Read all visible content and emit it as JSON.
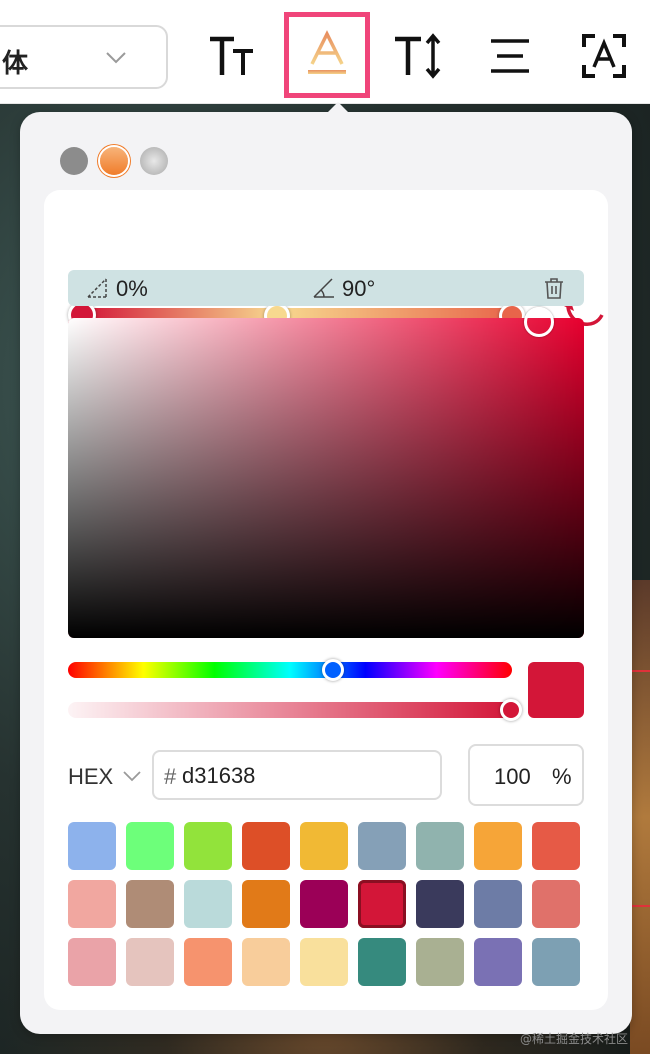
{
  "toolbar": {
    "font_select": {
      "label": "体",
      "icon": "chevron-down-icon"
    },
    "tools": [
      {
        "icon": "text-size-icon"
      },
      {
        "icon": "text-color-gradient-icon",
        "active": true
      },
      {
        "icon": "line-height-icon"
      },
      {
        "icon": "text-align-center-icon"
      },
      {
        "icon": "text-stroke-icon"
      }
    ]
  },
  "color_picker": {
    "modes": [
      {
        "name": "solid",
        "color": "#8c8c8c"
      },
      {
        "name": "linear-gradient",
        "color": "#f07c2a",
        "selected": true
      },
      {
        "name": "radial-gradient",
        "color": "#bdbdbd"
      }
    ],
    "gradient": {
      "stops": [
        {
          "color": "#d31638",
          "position": 0
        },
        {
          "color": "#f7d98f",
          "position": 0.45
        },
        {
          "color": "#e8654a",
          "position": 1
        }
      ],
      "reset_icon": "rotate-ccw-icon"
    },
    "angle_bar": {
      "position_value": "0%",
      "angle_value": "90°",
      "delete_icon": "trash-icon"
    },
    "hue": 0.6,
    "alpha": 1.0,
    "format_label": "HEX",
    "hash": "#",
    "hex_value": "d31638",
    "opacity_value": "100",
    "opacity_unit": "%",
    "swatches": [
      "#8db2ec",
      "#6dff7a",
      "#92e33b",
      "#dd4f27",
      "#f1b934",
      "#85a0b7",
      "#90b3ae",
      "#f6a538",
      "#e65a46",
      "#f1a7a0",
      "#af8c76",
      "#badada",
      "#e17a18",
      "#9b0057",
      "#d31638",
      "#3a3a5c",
      "#6d7ca6",
      "#e0716a",
      "#eaa3a8",
      "#e5c4be",
      "#f6936e",
      "#f8cd9b",
      "#f9e09c",
      "#368a7e",
      "#a9b092",
      "#7a71b4",
      "#7da0b3"
    ],
    "selected_swatch": 14
  },
  "watermark": "@稀土掘金技术社区"
}
